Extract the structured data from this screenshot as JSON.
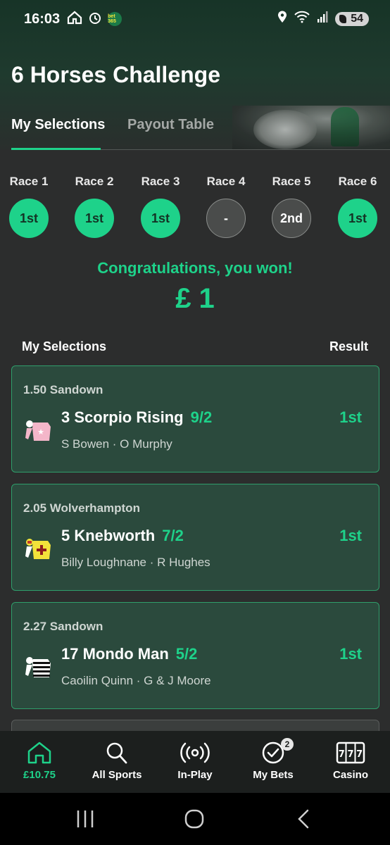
{
  "status_bar": {
    "time": "16:03",
    "battery": "54",
    "app_badge": "bet 365",
    "icons": [
      "home-icon",
      "alarm-icon",
      "bet365-icon",
      "location-icon",
      "wifi-icon",
      "signal-icon",
      "battery-icon"
    ]
  },
  "page": {
    "title": "6 Horses Challenge"
  },
  "tabs": [
    {
      "label": "My Selections",
      "active": true
    },
    {
      "label": "Payout Table",
      "active": false
    }
  ],
  "races": [
    {
      "label": "Race 1",
      "result": "1st",
      "won": true
    },
    {
      "label": "Race 2",
      "result": "1st",
      "won": true
    },
    {
      "label": "Race 3",
      "result": "1st",
      "won": true
    },
    {
      "label": "Race 4",
      "result": "-",
      "won": false
    },
    {
      "label": "Race 5",
      "result": "2nd",
      "won": false
    },
    {
      "label": "Race 6",
      "result": "1st",
      "won": true
    }
  ],
  "win": {
    "message": "Congratulations, you won!",
    "amount": "£ 1"
  },
  "columns": {
    "left": "My Selections",
    "right": "Result"
  },
  "selections": [
    {
      "meta": "1.50 Sandown",
      "horse": "3 Scorpio Rising",
      "odds": "9/2",
      "riders": "S Bowen · O Murphy",
      "result": "1st",
      "silks": "pink-star-silks-icon"
    },
    {
      "meta": "2.05 Wolverhampton",
      "horse": "5 Knebworth",
      "odds": "7/2",
      "riders": "Billy Loughnane · R Hughes",
      "result": "1st",
      "silks": "yellow-cross-silks-icon"
    },
    {
      "meta": "2.27 Sandown",
      "horse": "17 Mondo Man",
      "odds": "5/2",
      "riders": "Caoilin Quinn · G & J Moore",
      "result": "1st",
      "silks": "black-white-hoops-silks-icon"
    }
  ],
  "bottom_nav": [
    {
      "label": "£10.75",
      "icon": "home-icon",
      "active": true
    },
    {
      "label": "All Sports",
      "icon": "search-icon",
      "active": false
    },
    {
      "label": "In-Play",
      "icon": "in-play-icon",
      "active": false
    },
    {
      "label": "My Bets",
      "icon": "check-circle-icon",
      "active": false,
      "badge": "2"
    },
    {
      "label": "Casino",
      "icon": "slot-machine-icon",
      "active": false
    }
  ],
  "colors": {
    "accent": "#1ed28a",
    "card_bg": "#2b4a3d",
    "card_border": "#2f9e6b",
    "nav_bg": "#1c1f1e"
  }
}
